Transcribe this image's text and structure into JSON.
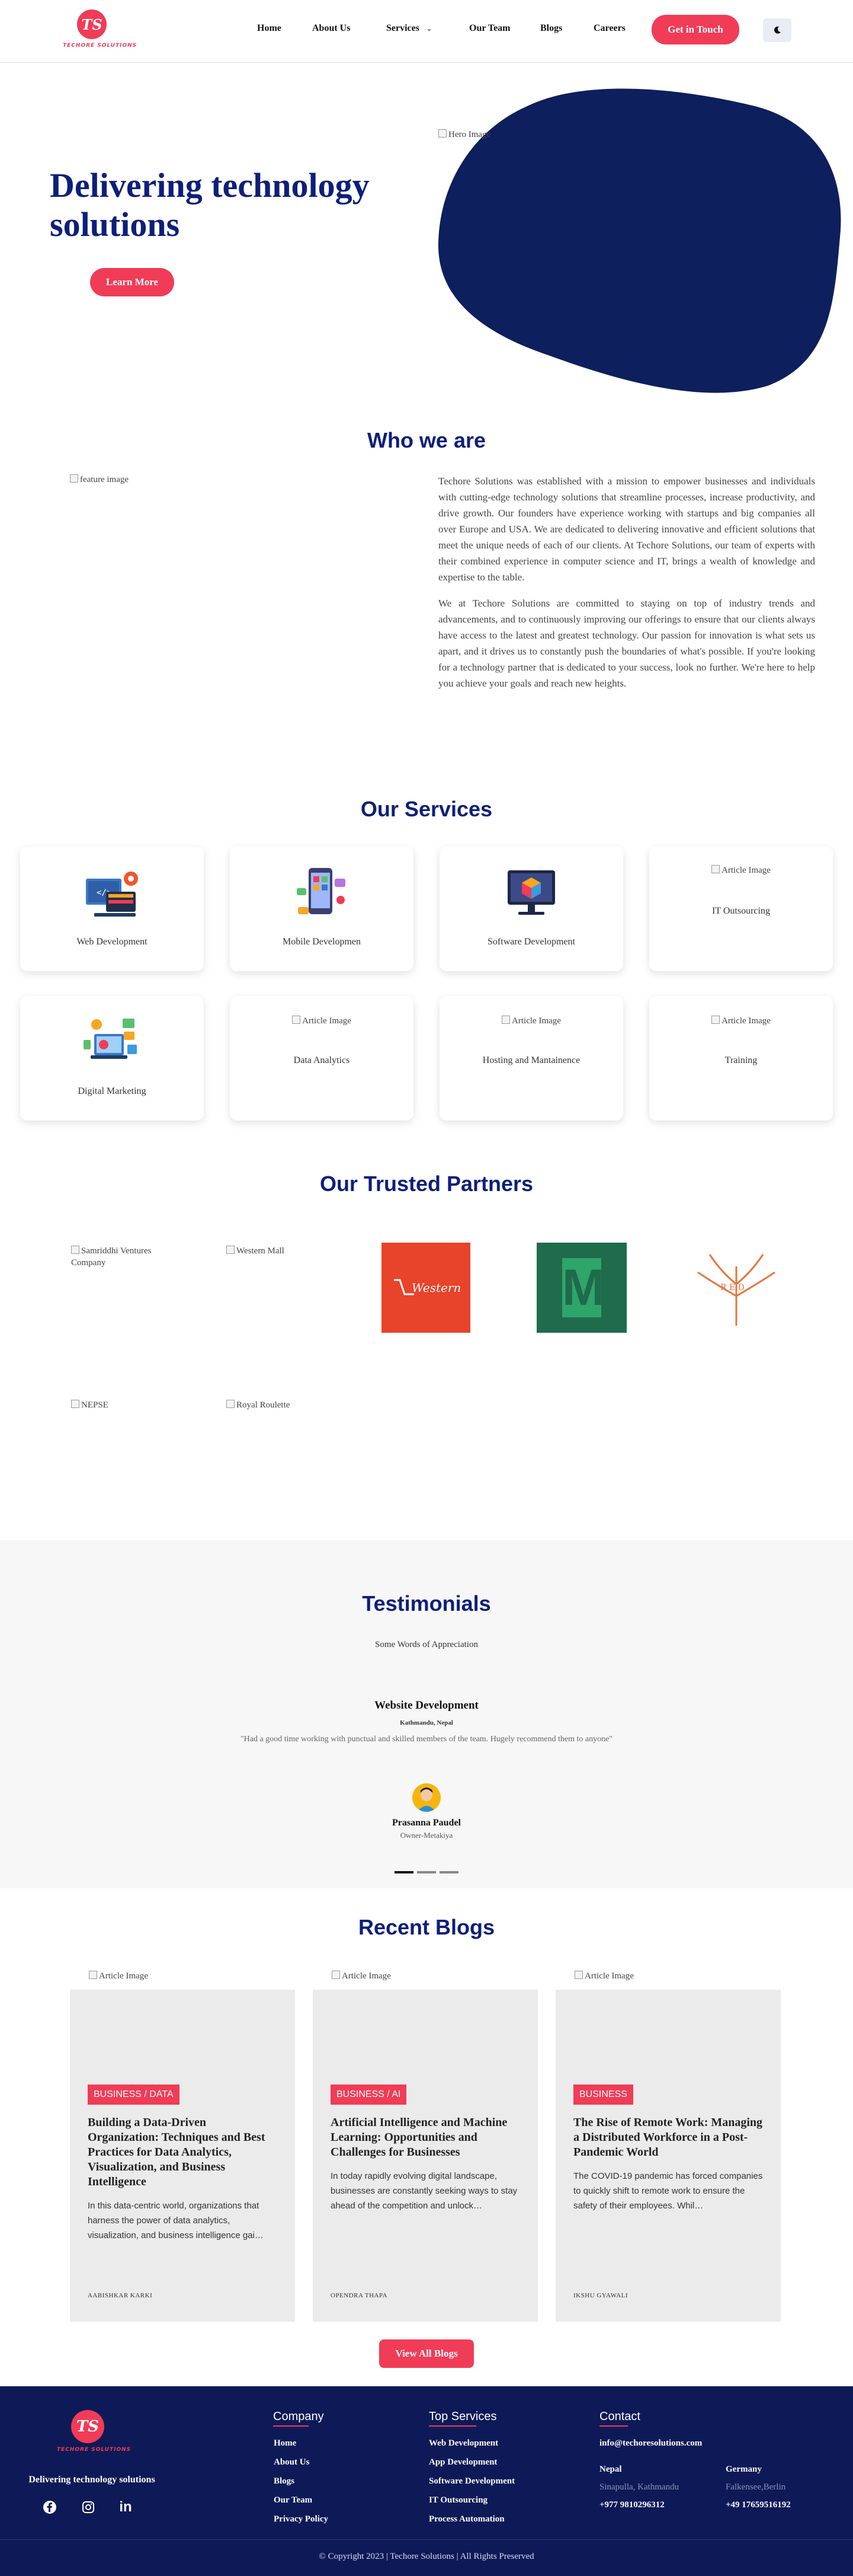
{
  "brand": {
    "initials": "TS",
    "name": "TECHORE SOLUTIONS",
    "accent": "#f03c57",
    "navy": "#0d1f7a"
  },
  "nav": {
    "items": [
      "Home",
      "About Us",
      "Services",
      "Our Team",
      "Blogs",
      "Careers"
    ],
    "services_chevron": "chevron-down-icon",
    "cta": "Get in Touch",
    "theme_icon": "moon-icon"
  },
  "hero": {
    "title": "Delivering technology solutions",
    "button": "Learn More",
    "image_alt": "Hero Image"
  },
  "about": {
    "title": "Who we are",
    "image_alt": "feature image",
    "paragraphs": [
      "Techore Solutions was established with a mission to empower businesses and individuals with cutting-edge technology solutions that streamline processes, increase productivity, and drive growth. Our founders have experience working with startups and big companies all over Europe and USA. We are dedicated to delivering innovative and efficient solutions that meet the unique needs of each of our clients. At Techore Solutions, our team of experts with their combined experience in computer science and IT, brings a wealth of knowledge and expertise to the table.",
      "We at Techore Solutions are committed to staying on top of industry trends and advancements, and to continuously improving our offerings to ensure that our clients always have access to the latest and greatest technology. Our passion for innovation is what sets us apart, and it drives us to constantly push the boundaries of what's possible. If you're looking for a technology partner that is dedicated to your success, look no further. We're here to help you achieve your goals and reach new heights."
    ]
  },
  "services": {
    "title": "Our Services",
    "broken_alt": "Article Image",
    "items": [
      {
        "label": "Web Development",
        "icon": "web-development-icon"
      },
      {
        "label": "Mobile Developmen",
        "icon": "mobile-development-icon"
      },
      {
        "label": "Software Development",
        "icon": "software-development-icon"
      },
      {
        "label": "IT Outsourcing",
        "icon": ""
      },
      {
        "label": "Digital Marketing",
        "icon": "digital-marketing-icon"
      },
      {
        "label": "Data Analytics",
        "icon": ""
      },
      {
        "label": "Hosting and Mantainence",
        "icon": ""
      },
      {
        "label": "Training",
        "icon": ""
      }
    ]
  },
  "partners": {
    "title": "Our Trusted Partners",
    "broken": [
      "Samriddhi Ventures Company",
      "Western Mall",
      "NEPSE",
      "Royal Roulette"
    ],
    "logos": [
      {
        "text": "Western",
        "bg": "#e8432b"
      },
      {
        "text": "M",
        "bg": "#1f6b4c"
      },
      {
        "text": "R E D",
        "color": "#e8753d"
      }
    ]
  },
  "testimonials": {
    "title": "Testimonials",
    "subtitle": "Some Words of Appreciation",
    "service": "Website Development",
    "location": "Kathmandu, Nepal",
    "quote": "\"Had a good time working with punctual and skilled members of the team. Hugely recommend them to anyone\"",
    "name": "Prasanna Paudel",
    "role": "Owner-Metakiya",
    "slides": 3,
    "active_slide": 1
  },
  "blogs": {
    "title": "Recent Blogs",
    "image_alt": "Article Image",
    "button": "View All Blogs",
    "items": [
      {
        "tag": "BUSINESS / DATA",
        "title": "Building a Data-Driven Organization: Techniques and Best Practices for Data Analytics, Visualization, and Business Intelligence",
        "excerpt": "In this data-centric world, organizations that harness the power of data analytics, visualization, and business intelligence gai…",
        "author": "AABISHKAR KARKI"
      },
      {
        "tag": "BUSINESS / AI",
        "title": "Artificial Intelligence and Machine Learning: Opportunities and Challenges for Businesses",
        "excerpt": "In today rapidly evolving digital landscape, businesses are constantly seeking ways to stay ahead of the competition and unlock…",
        "author": "OPENDRA THAPA"
      },
      {
        "tag": "BUSINESS",
        "title": "The Rise of Remote Work: Managing a Distributed Workforce in a Post-Pandemic World",
        "excerpt": "The COVID-19 pandemic has forced companies to quickly shift to remote work to ensure the safety of their employees. Whil…",
        "author": "IKSHU GYAWALI"
      }
    ]
  },
  "footer": {
    "tagline": "Delivering technology solutions",
    "company_title": "Company",
    "company_links": [
      "Home",
      "About Us",
      "Blogs",
      "Our Team",
      "Privacy Policy"
    ],
    "services_title": "Top Services",
    "service_links": [
      "Web Development",
      "App Development",
      "Software Development",
      "IT Outsourcing",
      "Process Automation"
    ],
    "contact_title": "Contact",
    "email": "info@techoresolutions.com",
    "offices": [
      {
        "country": "Nepal",
        "city": "Sinapulla, Kathmandu",
        "phone": "+977 9810296312"
      },
      {
        "country": "Germany",
        "city": "Falkensee,Berlin",
        "phone": "+49 17659516192"
      }
    ],
    "socials": [
      "facebook-icon",
      "instagram-icon",
      "linkedin-icon"
    ],
    "copyright": "© Copyright 2023 | Techore Solutions | All Rights Preserved"
  }
}
